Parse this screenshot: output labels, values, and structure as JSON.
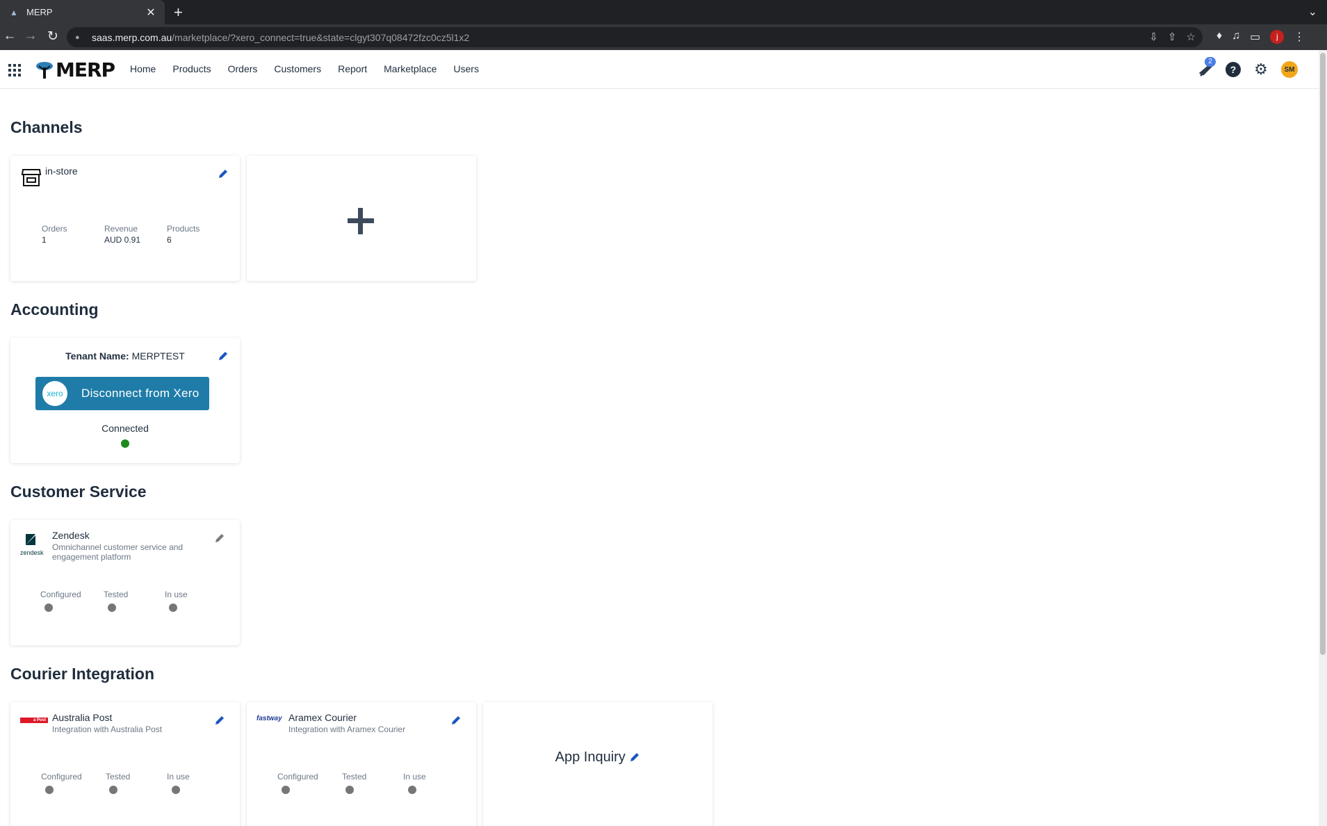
{
  "browser": {
    "tab_title": "MERP",
    "url_host": "saas.merp.com.au",
    "url_path": "/marketplace/?xero_connect=true&state=clgyt307q08472fzc0cz5l1x2",
    "profile_initial": "j"
  },
  "header": {
    "logo": "MERP",
    "nav": [
      "Home",
      "Products",
      "Orders",
      "Customers",
      "Report",
      "Marketplace",
      "Users"
    ],
    "notification_count": "2",
    "help": "?",
    "avatar": "SM"
  },
  "channels": {
    "title": "Channels",
    "card": {
      "name": "in-store",
      "stats": [
        {
          "label": "Orders",
          "value": "1"
        },
        {
          "label": "Revenue",
          "value": "AUD 0.91"
        },
        {
          "label": "Products",
          "value": "6"
        }
      ]
    }
  },
  "accounting": {
    "title": "Accounting",
    "tenant_label": "Tenant Name:",
    "tenant_value": "MERPTEST",
    "xero_logo": "xero",
    "button": "Disconnect from Xero",
    "status": "Connected",
    "status_color": "#1e8a1e"
  },
  "customer_service": {
    "title": "Customer Service",
    "card": {
      "name": "Zendesk",
      "description": "Omnichannel customer service and engagement platform",
      "logo_text": "zendesk",
      "statuses": [
        "Configured",
        "Tested",
        "In use"
      ]
    }
  },
  "courier": {
    "title": "Courier Integration",
    "cards": [
      {
        "name": "Australia Post",
        "description": "Integration with Australia Post",
        "logo_text": "a Post",
        "statuses": [
          "Configured",
          "Tested",
          "In use"
        ]
      },
      {
        "name": "Aramex Courier",
        "description": "Integration with Aramex Courier",
        "logo_text": "fastway",
        "statuses": [
          "Configured",
          "Tested",
          "In use"
        ]
      }
    ],
    "inquiry": "App Inquiry"
  }
}
